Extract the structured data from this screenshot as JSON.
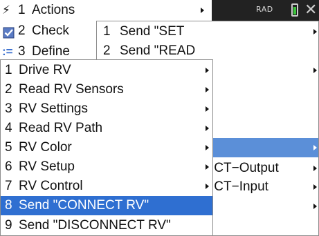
{
  "status": {
    "angle_mode": "RAD",
    "battery_level": 0.8,
    "close_glyph": "✕"
  },
  "main_menu": {
    "items": [
      {
        "num": "1",
        "label": "Actions",
        "icon": "lightning-icon",
        "glyph": "⚡"
      },
      {
        "num": "2",
        "label": "Check",
        "icon": "checkbox-icon",
        "glyph": "☑"
      },
      {
        "num": "3",
        "label": "Define",
        "icon": "define-icon",
        "glyph": ":="
      }
    ]
  },
  "send_menu": {
    "items": [
      {
        "num": "1",
        "label": "Send \"SET"
      },
      {
        "num": "2",
        "label": "Send \"READ"
      }
    ]
  },
  "io_menu": {
    "items": [
      {
        "label": ":CT−Output"
      },
      {
        "label": ":CT−Input"
      }
    ]
  },
  "rv_menu": {
    "selected_index": 7,
    "items": [
      {
        "num": "1",
        "label": "Drive RV"
      },
      {
        "num": "2",
        "label": "Read RV Sensors"
      },
      {
        "num": "3",
        "label": "RV Settings"
      },
      {
        "num": "4",
        "label": "Read RV Path"
      },
      {
        "num": "5",
        "label": "RV Color"
      },
      {
        "num": "6",
        "label": "RV Setup"
      },
      {
        "num": "7",
        "label": "RV Control"
      },
      {
        "num": "8",
        "label": "Send \"CONNECT RV\""
      },
      {
        "num": "9",
        "label": "Send \"DISCONNECT RV\""
      }
    ]
  },
  "colors": {
    "selection": "#2f6fd1",
    "parent_highlight": "#5b8fd8"
  }
}
